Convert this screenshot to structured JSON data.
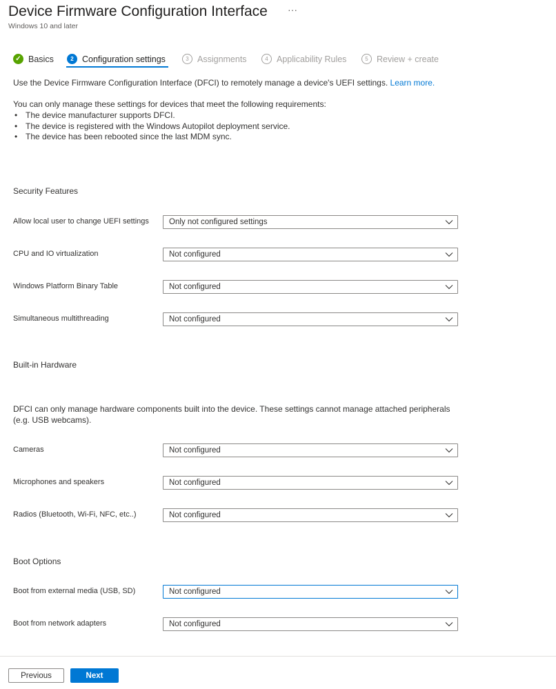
{
  "header": {
    "title": "Device Firmware Configuration Interface",
    "more_icon": "ellipsis-icon",
    "more_label": "···",
    "subtitle": "Windows 10 and later"
  },
  "wizard": {
    "steps": [
      {
        "label": "Basics",
        "marker": "✓",
        "state": "complete"
      },
      {
        "label": "Configuration settings",
        "marker": "2",
        "state": "active"
      },
      {
        "label": "Assignments",
        "marker": "3",
        "state": "pending"
      },
      {
        "label": "Applicability Rules",
        "marker": "4",
        "state": "pending"
      },
      {
        "label": "Review + create",
        "marker": "5",
        "state": "pending"
      }
    ]
  },
  "intro": {
    "text": "Use the Device Firmware Configuration Interface (DFCI) to remotely manage a device's UEFI settings.",
    "link": "Learn more.",
    "requirements_heading": "You can only manage these settings for devices that meet the following requirements:",
    "requirements": [
      "The device manufacturer supports DFCI.",
      "The device is registered with the Windows Autopilot deployment service.",
      "The device has been rebooted since the last MDM sync."
    ]
  },
  "sections": {
    "security": {
      "title": "Security Features",
      "settings": [
        {
          "label": "Allow local user to change UEFI settings",
          "value": "Only not configured settings"
        },
        {
          "label": "CPU and IO virtualization",
          "value": "Not configured"
        },
        {
          "label": "Windows Platform Binary Table",
          "value": "Not configured"
        },
        {
          "label": "Simultaneous multithreading",
          "value": "Not configured"
        }
      ]
    },
    "hardware": {
      "title": "Built-in Hardware",
      "description_line1": "DFCI can only manage hardware components built into the device. These settings cannot manage attached peripherals",
      "description_line2": "(e.g. USB webcams).",
      "settings": [
        {
          "label": "Cameras",
          "value": "Not configured"
        },
        {
          "label": "Microphones and speakers",
          "value": "Not configured"
        },
        {
          "label": "Radios (Bluetooth, Wi-Fi, NFC, etc..)",
          "value": "Not configured"
        }
      ]
    },
    "boot": {
      "title": "Boot Options",
      "settings": [
        {
          "label": "Boot from external media (USB, SD)",
          "value": "Not configured"
        },
        {
          "label": "Boot from network adapters",
          "value": "Not configured"
        }
      ]
    }
  },
  "footer": {
    "previous_label": "Previous",
    "next_label": "Next"
  },
  "colors": {
    "accent": "#0078d4",
    "complete": "#57a300"
  }
}
